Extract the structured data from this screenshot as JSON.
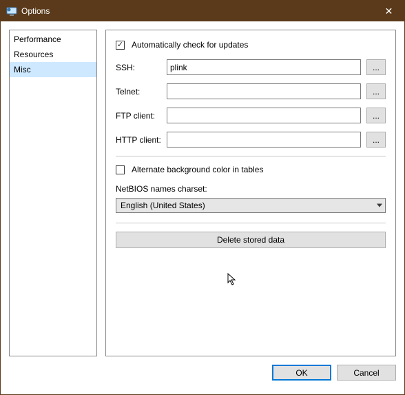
{
  "window": {
    "title": "Options",
    "close_glyph": "✕"
  },
  "sidebar": {
    "items": [
      {
        "label": "Performance",
        "selected": false
      },
      {
        "label": "Resources",
        "selected": false
      },
      {
        "label": "Misc",
        "selected": true
      }
    ]
  },
  "panel": {
    "auto_update": {
      "label": "Automatically check for updates",
      "checked": true
    },
    "fields": [
      {
        "key": "ssh",
        "label": "SSH:",
        "value": "plink",
        "browse": "..."
      },
      {
        "key": "telnet",
        "label": "Telnet:",
        "value": "",
        "browse": "..."
      },
      {
        "key": "ftp",
        "label": "FTP client:",
        "value": "",
        "browse": "..."
      },
      {
        "key": "http",
        "label": "HTTP client:",
        "value": "",
        "browse": "..."
      }
    ],
    "alt_bg": {
      "label": "Alternate background color in tables",
      "checked": false
    },
    "charset_label": "NetBIOS names charset:",
    "charset_value": "English (United States)",
    "delete_btn": "Delete stored data"
  },
  "footer": {
    "ok": "OK",
    "cancel": "Cancel"
  }
}
